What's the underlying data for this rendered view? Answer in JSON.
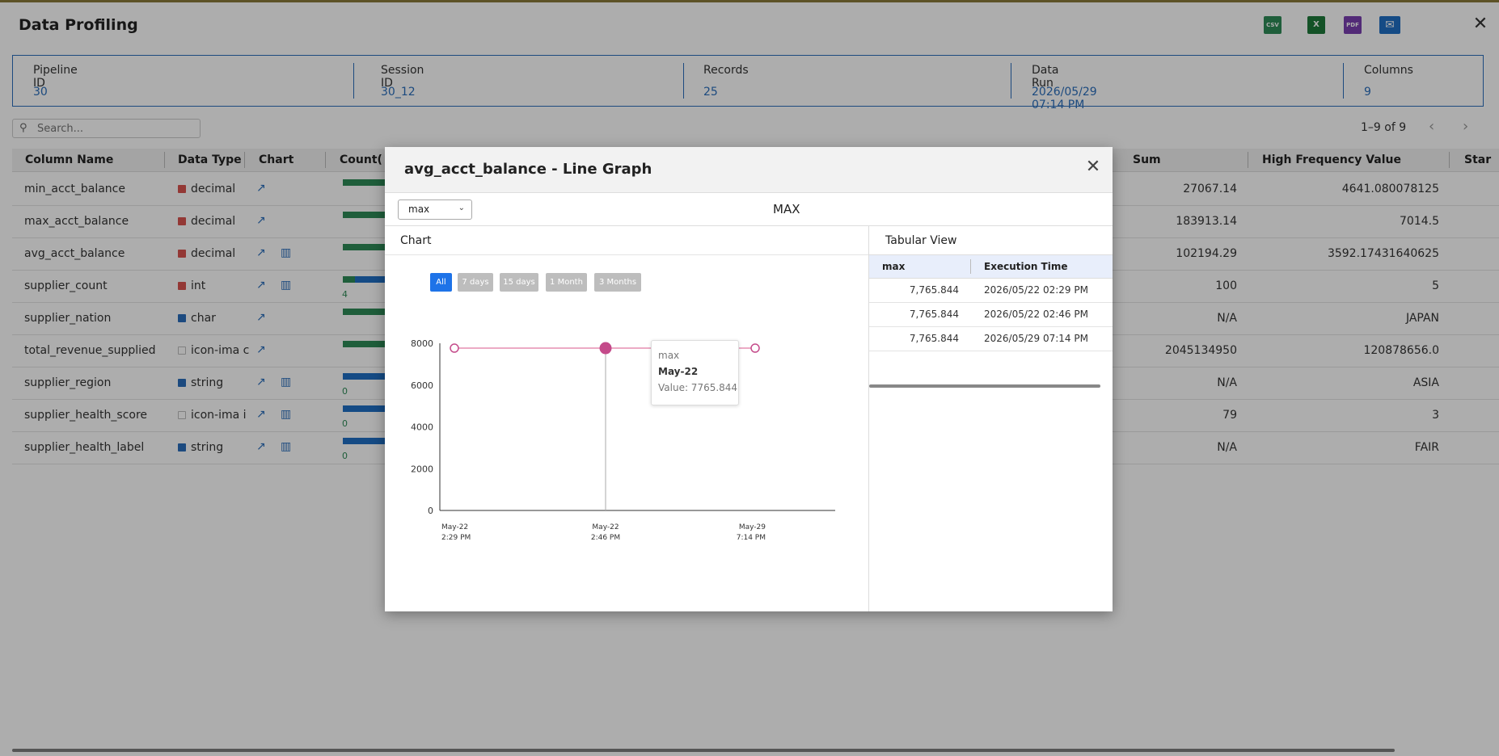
{
  "header": {
    "title": "Data Profiling",
    "icons": [
      "csv-download-icon",
      "excel-download-icon",
      "report-icon",
      "email-icon"
    ],
    "icon_labels": [
      "CSV",
      "X",
      "PDF",
      "✉"
    ]
  },
  "info": [
    {
      "label": "Pipeline ID",
      "value": "30"
    },
    {
      "label": "Session ID",
      "value": "30_12"
    },
    {
      "label": "Records",
      "value": "25"
    },
    {
      "label": "Data Run",
      "value": "2026/05/29 07:14 PM"
    },
    {
      "label": "Columns",
      "value": "9"
    }
  ],
  "search": {
    "placeholder": "Search..."
  },
  "pagination": {
    "text": "1–9 of 9"
  },
  "table": {
    "headers": [
      "Column Name",
      "Data Type",
      "Chart",
      "Count(",
      "Sum",
      "High Frequency Value",
      "Star"
    ],
    "rows": [
      {
        "name": "min_acct_balance",
        "dtype": "decimal",
        "dtype_kind": "numeric",
        "sum": "27067.14",
        "hfv": "4641.080078125",
        "bar_label": ""
      },
      {
        "name": "max_acct_balance",
        "dtype": "decimal",
        "dtype_kind": "numeric",
        "sum": "183913.14",
        "hfv": "7014.5",
        "bar_label": ""
      },
      {
        "name": "avg_acct_balance",
        "dtype": "decimal",
        "dtype_kind": "numeric",
        "sum": "102194.29",
        "hfv": "3592.17431640625",
        "bar_label": ""
      },
      {
        "name": "supplier_count",
        "dtype": "int",
        "dtype_kind": "numeric",
        "sum": "100",
        "hfv": "5",
        "bar_label": "4"
      },
      {
        "name": "supplier_nation",
        "dtype": "char",
        "dtype_kind": "text",
        "sum": "N/A",
        "hfv": "JAPAN",
        "bar_label": ""
      },
      {
        "name": "total_revenue_supplied",
        "dtype": "icon-ima c",
        "dtype_kind": "broken",
        "sum": "2045134950",
        "hfv": "120878656.0",
        "bar_label": ""
      },
      {
        "name": "supplier_region",
        "dtype": "string",
        "dtype_kind": "text",
        "sum": "N/A",
        "hfv": "ASIA",
        "bar_label": "0"
      },
      {
        "name": "supplier_health_score",
        "dtype": "icon-ima i",
        "dtype_kind": "broken",
        "sum": "79",
        "hfv": "3",
        "bar_label": "0"
      },
      {
        "name": "supplier_health_label",
        "dtype": "string",
        "dtype_kind": "text",
        "sum": "N/A",
        "hfv": "FAIR",
        "bar_label": "0"
      }
    ]
  },
  "modal": {
    "title": "avg_acct_balance - Line Graph",
    "select_value": "max",
    "metric_label": "MAX",
    "chart_panel_title": "Chart",
    "table_panel_title": "Tabular View",
    "range_buttons": [
      "All",
      "7 days",
      "15 days",
      "1 Month",
      "3 Months"
    ],
    "tooltip": {
      "series": "max",
      "x": "May-22",
      "value": "Value: 7765.844"
    },
    "tabular": {
      "headers": [
        "max",
        "Execution Time"
      ],
      "rows": [
        [
          "7,765.844",
          "2026/05/22 02:29 PM"
        ],
        [
          "7,765.844",
          "2026/05/22 02:46 PM"
        ],
        [
          "7,765.844",
          "2026/05/29 07:14 PM"
        ]
      ]
    }
  },
  "chart_data": {
    "type": "line",
    "x": [
      "May-22 2:29 PM",
      "May-22 2:46 PM",
      "May-29 7:14 PM"
    ],
    "x_tick_lines": [
      [
        "May-22",
        "2:29 PM"
      ],
      [
        "May-22",
        "2:46 PM"
      ],
      [
        "May-29",
        "7:14 PM"
      ]
    ],
    "series": [
      {
        "name": "max",
        "values": [
          7765.844,
          7765.844,
          7765.844
        ]
      }
    ],
    "yticks": [
      0,
      2000,
      4000,
      6000,
      8000
    ],
    "ylim": [
      0,
      8000
    ],
    "highlighted_index": 1,
    "colors": {
      "line": "#e58fb2",
      "marker": "#c44a8a"
    }
  }
}
